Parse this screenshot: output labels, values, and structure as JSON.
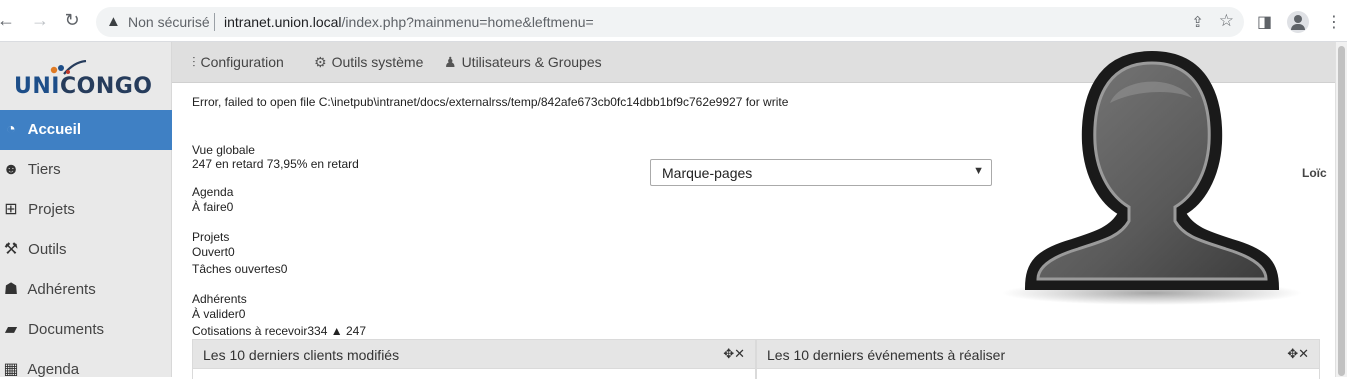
{
  "browser": {
    "insecure_label": "Non sécurisé",
    "url_host": "intranet.union.local",
    "url_path": "/index.php?mainmenu=home&leftmenu="
  },
  "logo": {
    "part1": "UNI",
    "part2": "CONGO"
  },
  "sidebar": {
    "items": [
      {
        "label": "Accueil",
        "icon": "gauge-icon",
        "glyph": "◔"
      },
      {
        "label": "Tiers",
        "icon": "users-icon",
        "glyph": "👥"
      },
      {
        "label": "Projets",
        "icon": "sitemap-icon",
        "glyph": "⊞"
      },
      {
        "label": "Outils",
        "icon": "tools-icon",
        "glyph": "⚒"
      },
      {
        "label": "Adhérents",
        "icon": "member-icon",
        "glyph": "👤"
      },
      {
        "label": "Documents",
        "icon": "folder-open-icon",
        "glyph": "📂"
      },
      {
        "label": "Agenda",
        "icon": "calendar-icon",
        "glyph": "▦"
      }
    ]
  },
  "topmenu": {
    "configuration": "Configuration",
    "outils_systeme": "Outils système",
    "utilisateurs": "Utilisateurs & Groupes"
  },
  "main": {
    "error": "Error, failed to open file C:\\inetpub\\intranet/docs/externalrss/temp/842afe673cb0fc14dbb1bf9c762e9927 for write",
    "vue_globale": "Vue globale",
    "vue_globale_line": "247 en retard 73,95% en retard",
    "agenda": "Agenda",
    "agenda_line": "À faire0",
    "projets": "Projets",
    "projets_line1": "Ouvert0",
    "projets_line2": "Tâches ouvertes0",
    "adherents": "Adhérents",
    "adherents_line1": "À valider0",
    "adherents_line2a": "Cotisations à recevoir334",
    "adherents_line2b": "247",
    "bookmarks_selected": "Marque-pages",
    "username": "Loïc",
    "box1_title": "Les 10 derniers clients modifiés",
    "box2_title": "Les 10 derniers événements à réaliser"
  },
  "colors": {
    "accent": "#3f80c4",
    "sidebar_bg": "#e9e9e9",
    "topmenu_bg": "#dfdfdf"
  }
}
